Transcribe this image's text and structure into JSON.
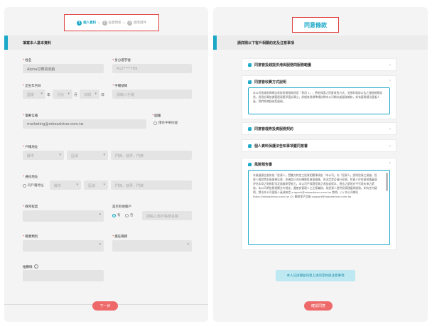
{
  "stepper": {
    "steps": [
      {
        "num": "1",
        "label": "個人資料"
      },
      {
        "num": "2",
        "label": "投資問卷"
      },
      {
        "num": "3",
        "label": "進階證件"
      }
    ],
    "sep": "›"
  },
  "form": {
    "section_title": "填寫本人基本資料",
    "name": {
      "label": "姓名",
      "value": "Alpha打轉買收銷"
    },
    "id_no": {
      "label": "身分證字號",
      "value": "A12****789"
    },
    "birthday": {
      "label": "出生年月日",
      "year_ph": "國家",
      "year_unit": "年",
      "month_ph": "月份",
      "month_unit": "月",
      "day_ph": "日期",
      "day_unit": "日"
    },
    "phone": {
      "label": "手機號碼",
      "placeholder": "請輸入手機"
    },
    "email": {
      "label": "電郵信箱",
      "value": "marketing@roboadvisor.com.tw"
    },
    "country": {
      "label": "國籍",
      "option": "僅有中華民國"
    },
    "household": {
      "label": "戶籍地址",
      "city_ph": "縣市",
      "district_ph": "區域",
      "detail_ph": "門牌、巷弄、門牌"
    },
    "mailing": {
      "label": "通訊地址",
      "same": "同戶籍地址",
      "city_ph": "縣市",
      "district_ph": "區域",
      "detail_ph": "門牌、巷弄、門牌"
    },
    "education": {
      "label": "教育程度"
    },
    "other_account": {
      "label": "是否有他帳戶",
      "yes": "有",
      "no": "否",
      "placeholder": "請輸入他戶帳號名稱"
    },
    "occupation": {
      "label": "職業類別"
    },
    "industry": {
      "label": "擔任職務"
    },
    "referral": {
      "label": "推薦碼"
    },
    "next_button": "下一步"
  },
  "agreement": {
    "title": "同意條款",
    "section_title": "請詳閱以下客戶相關約定及注意事項",
    "items": [
      {
        "label": "同意管投錢提供港與服務問服務範圍",
        "expanded": false
      },
      {
        "label": "同意管收費方式說明",
        "expanded": true,
        "body": "本公司依據前揭規定收取投資服務費用「費用 1」，將依保證之投資收費方式，並依財政部公告之服務規範收費，費用計算依據管理資產淨值計算之，詳細收費標準請詳閱本公司網站或服務條款，如有疑問請洽客服人員，我們將竭誠為您服務。"
      },
      {
        "label": "同意管理券投資服務契約",
        "expanded": false
      },
      {
        "label": "個人資料保護法告知事項暨同意書",
        "expanded": false
      },
      {
        "label": "風險預告書",
        "expanded": true,
        "body": "本風險預告書係依「投資人」暨雙方約定之投資相關事項由「本公司」向「投資人」說明投資之風險，投資人應詳閱本風險預告書，並確認已充分瞭解投資風險後，再決定是否進行投資。投資人於投資前應審慎評估本身之財務狀況及風險承受能力，本公司不保證投資之收益或保本，過去之績效亦不代表未來之績效。本公司將依照相關法令規定，盡善良管理人之注意義務，為投資人提供投資建議與服務。如有任何疑問，請洽本公司客服人員或來信 support@roboadvisor.com.tw 詢問。(1) 本公司網站 https://roboadvisor.com.tw (2) 聯絡電子信箱 support@roboadvisor.com.tw"
      }
    ],
    "confirm_hint": "本人已詳閱並同意上述的定約與注意事項",
    "submit_button": "確認同意"
  },
  "colors": {
    "accent": "#1ba9c7",
    "button": "#ee6a6a",
    "highlight_border": "#e04040"
  }
}
